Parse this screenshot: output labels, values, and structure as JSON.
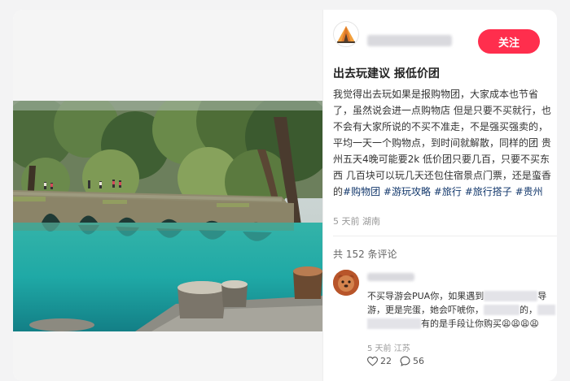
{
  "author": {
    "follow_label": "关注"
  },
  "post": {
    "title": "出去玩建议 报低价团",
    "body_text": "我觉得出去玩如果是报购物团，大家成本也节省了，虽然说会进一点购物店 但是只要不买就行，也不会有大家所说的不买不准走，不是强买强卖的，平均一天一个购物点，到时间就解散，同样的团 贵州五天4晚可能要2k 低价团只要几百，只要不买东西 几百块可以玩几天还包住宿景点门票，还是蛮香的",
    "tags": [
      "#购物团",
      "#游玩攻略",
      "#旅行",
      "#旅行搭子",
      "#贵州"
    ],
    "meta": "5 天前 湖南"
  },
  "comments_section": {
    "count_label": "共 152 条评论",
    "comments": [
      {
        "text_a": "不买导游会PUA你，如果遇到",
        "text_b": "导游，更是完蛋，她会吓唬你，",
        "text_c": "的，",
        "text_d": "有的是手段让你购买",
        "emoji": "😩😩😩😩",
        "meta": "5 天前 江苏",
        "likes": "22",
        "replies": "56"
      }
    ]
  },
  "colors": {
    "accent": "#ff2e4d",
    "tag": "#13386c",
    "water": "#1fa9a6"
  },
  "icons": {
    "author_avatar": "tent-icon",
    "like": "heart-icon",
    "reply": "chat-bubble-icon"
  }
}
